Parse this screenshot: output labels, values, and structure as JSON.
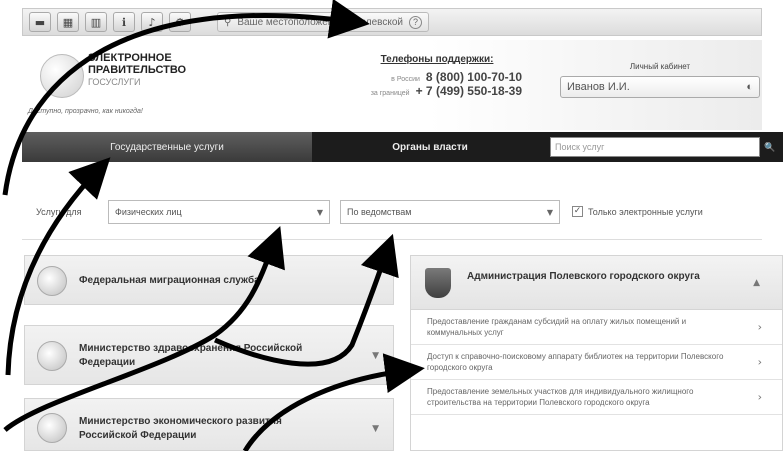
{
  "toolbar": {
    "icons": [
      "view-list-icon",
      "view-grid-icon",
      "view-columns-icon",
      "info-icon",
      "sound-icon",
      "settings-icon"
    ],
    "location_label": "Ваше местоположение:",
    "location_value": "Полевской",
    "help_glyph": "?"
  },
  "header": {
    "logo_line1": "ЭЛЕКТРОННОЕ",
    "logo_line2": "ПРАВИТЕЛЬСТВО",
    "logo_line3": "ГОСУСЛУГИ",
    "tagline": "Доступно, прозрачно, как никогда!",
    "phones_title": "Телефоны поддержки:",
    "phone1_label": "в России",
    "phone1": "8 (800) 100-70-10",
    "phone2_label": "за границей",
    "phone2": "+ 7 (499) 550-18-39",
    "cabinet_title": "Личный кабинет",
    "cabinet_user": "Иванов И.И."
  },
  "nav": {
    "tab1": "Государственные услуги",
    "tab2": "Органы власти",
    "search_placeholder": "Поиск услуг"
  },
  "filters": {
    "label": "Услуги для",
    "select1": "Физических лиц",
    "select2": "По ведомствам",
    "checkbox_label": "Только электронные услуги",
    "checkbox_checked": true
  },
  "left_cards": [
    {
      "title": "Федеральная миграционная служба"
    },
    {
      "title": "Министерство здравоохранения Российской Федерации"
    },
    {
      "title": "Министерство экономического развития Российской Федерации"
    }
  ],
  "right_panel": {
    "title": "Администрация Полевского городского округа",
    "items": [
      {
        "text": "Предоставление гражданам субсидий на оплату жилых помещений и коммунальных услуг"
      },
      {
        "text": "Доступ к справочно-поисковому аппарату библиотек на территории Полевского городского округа"
      },
      {
        "text": "Предоставление земельных участков для индивидуального жилищного строительства на территории Полевского городского округа"
      }
    ]
  }
}
